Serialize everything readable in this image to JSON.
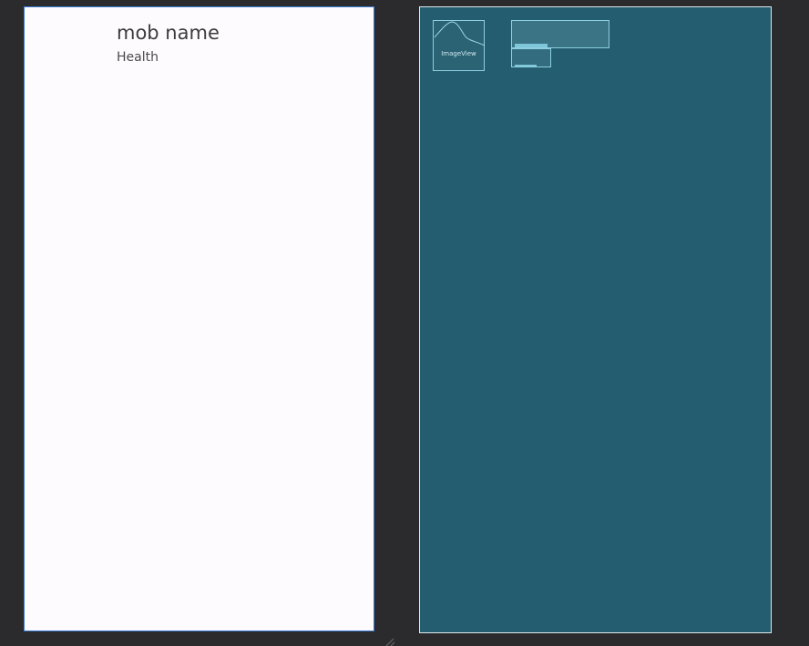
{
  "design_preview": {
    "mob_name": "mob name",
    "health_label": "Health"
  },
  "blueprint_preview": {
    "image_view_label": "ImageView"
  },
  "colors": {
    "background": "#2b2b2d",
    "design_surface": "#fefbff",
    "design_border": "#3a7bd5",
    "blueprint_surface": "#235d6f",
    "blueprint_outline": "#8dcfe0"
  },
  "icons": {
    "resize_handle": "resize-handle-icon"
  }
}
